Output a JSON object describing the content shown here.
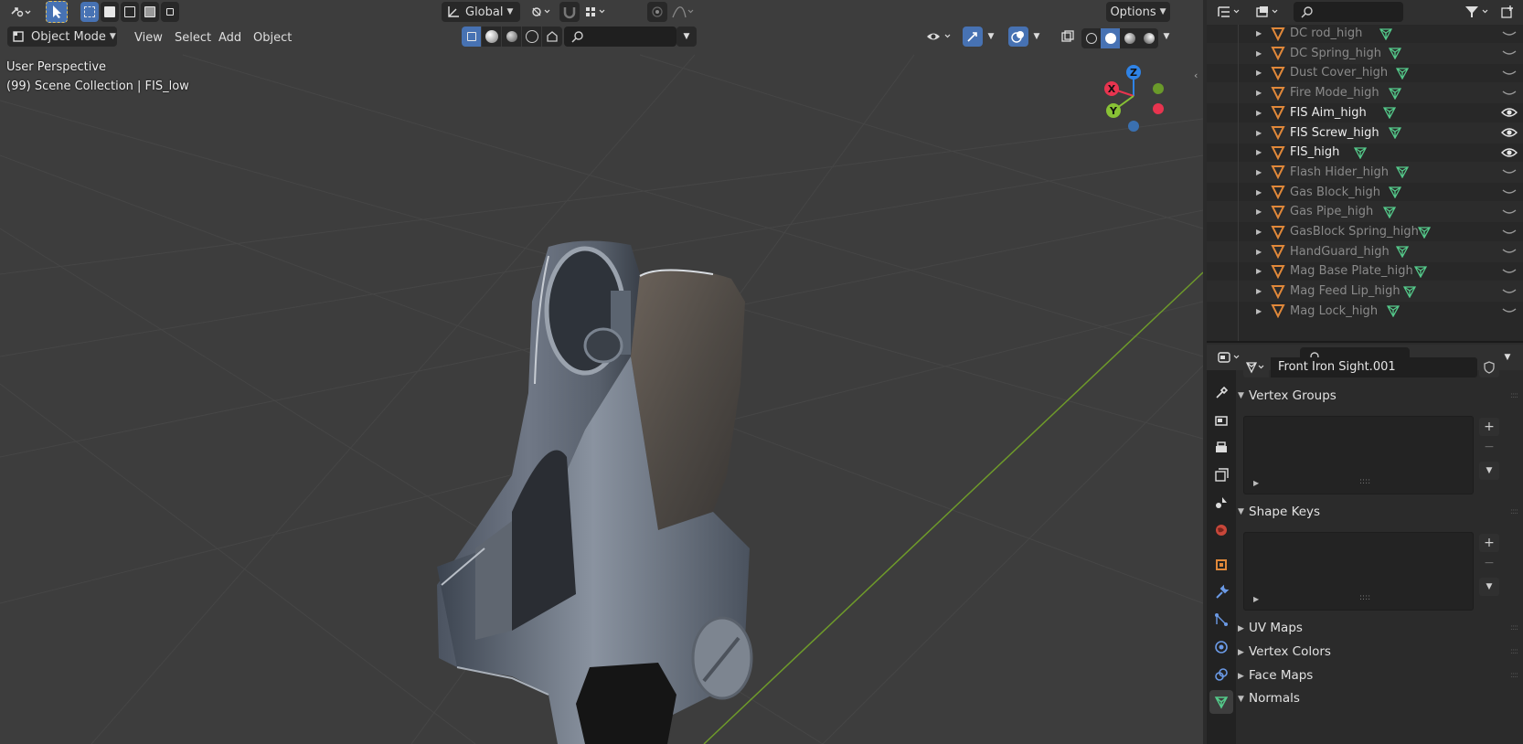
{
  "header": {
    "transform_orientation": "Global",
    "options_label": "Options"
  },
  "viewport_header": {
    "mode": "Object Mode",
    "menus": [
      "View",
      "Select",
      "Add",
      "Object"
    ]
  },
  "overlay": {
    "line1": "User Perspective",
    "line2": "(99) Scene Collection | FIS_low"
  },
  "gizmo": {
    "z": "Z",
    "x": "X",
    "y": "Y",
    "colors": {
      "x": "#e8344f",
      "y": "#88c235",
      "z": "#2f83e6",
      "neg": "#3a70b0"
    }
  },
  "outliner": {
    "items": [
      {
        "label": "DC rod_high",
        "visible": false
      },
      {
        "label": "DC Spring_high",
        "visible": false
      },
      {
        "label": "Dust Cover_high",
        "visible": false
      },
      {
        "label": "Fire Mode_high",
        "visible": false
      },
      {
        "label": "FIS Aim_high",
        "visible": true
      },
      {
        "label": "FIS Screw_high",
        "visible": true
      },
      {
        "label": "FIS_high",
        "visible": true
      },
      {
        "label": "Flash Hider_high",
        "visible": false
      },
      {
        "label": "Gas Block_high",
        "visible": false
      },
      {
        "label": "Gas Pipe_high",
        "visible": false
      },
      {
        "label": "GasBlock Spring_high",
        "visible": false
      },
      {
        "label": "HandGuard_high",
        "visible": false
      },
      {
        "label": "Mag Base Plate_high",
        "visible": false
      },
      {
        "label": "Mag Feed Lip_high",
        "visible": false
      },
      {
        "label": "Mag Lock_high",
        "visible": false
      }
    ]
  },
  "properties": {
    "mesh_name": "Front Iron Sight.001",
    "panels": {
      "vertex_groups": "Vertex Groups",
      "shape_keys": "Shape Keys",
      "uv_maps": "UV Maps",
      "vertex_colors": "Vertex Colors",
      "face_maps": "Face Maps",
      "normals": "Normals"
    }
  },
  "colors": {
    "accent": "#4772b3",
    "object_icon": "#e0883a",
    "mesh_icon": "#54c98a",
    "grid_axis": "#6e9a2a"
  }
}
